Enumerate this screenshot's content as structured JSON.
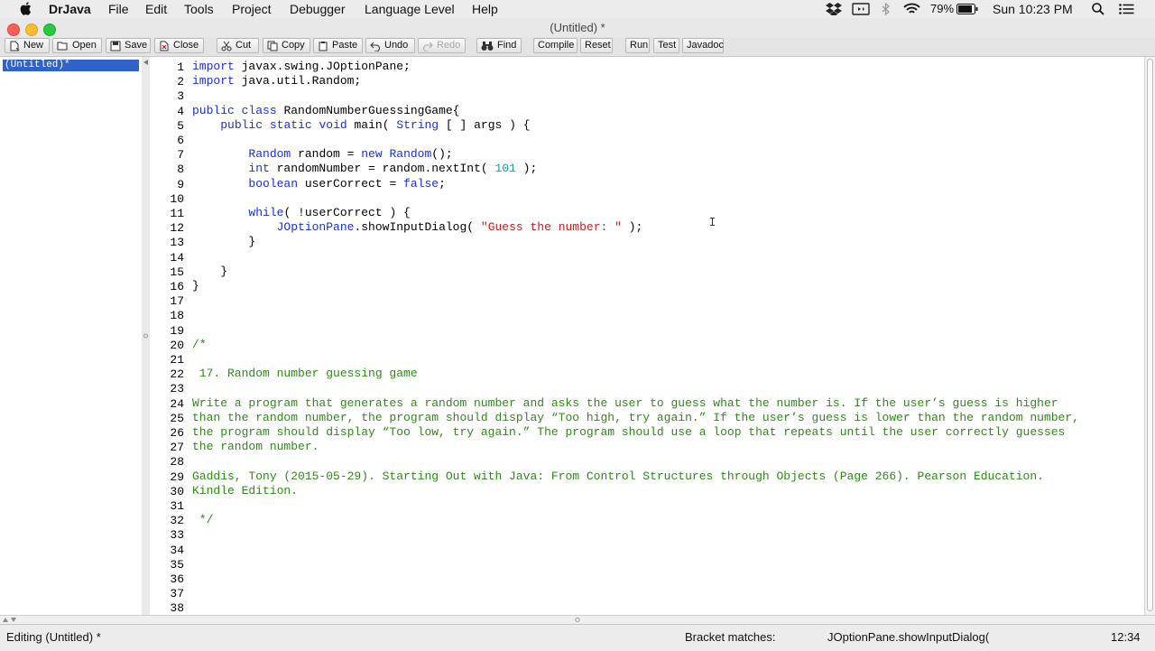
{
  "menubar": {
    "app_name": "DrJava",
    "items": [
      "File",
      "Edit",
      "Tools",
      "Project",
      "Debugger",
      "Language Level",
      "Help"
    ],
    "battery": "79%",
    "clock": "Sun 10:23 PM"
  },
  "window": {
    "title": "(Untitled) *"
  },
  "toolbar": {
    "new": "New",
    "open": "Open",
    "save": "Save",
    "close": "Close",
    "cut": "Cut",
    "copy": "Copy",
    "paste": "Paste",
    "undo": "Undo",
    "redo": "Redo",
    "find": "Find",
    "compile": "Compile",
    "reset": "Reset",
    "run": "Run",
    "test": "Test",
    "javadoc": "Javadoc"
  },
  "sidebar": {
    "documents": [
      "(Untitled)*"
    ]
  },
  "editor": {
    "line_numbers": [
      "1",
      "2",
      "3",
      "4",
      "5",
      "6",
      "7",
      "8",
      "9",
      "10",
      "11",
      "12",
      "13",
      "14",
      "15",
      "16",
      "17",
      "18",
      "19",
      "20",
      "21",
      "22",
      "23",
      "24",
      "25",
      "26",
      "27",
      "28",
      "29",
      "30",
      "31",
      "32",
      "33",
      "34",
      "35",
      "36",
      "37",
      "38"
    ],
    "lines": {
      "l1_kw": "import",
      "l1_rest": " javax.swing.JOptionPane;",
      "l2_kw": "import",
      "l2_rest": " java.util.Random;",
      "l4_kw1": "public",
      "l4_sp1": " ",
      "l4_kw2": "class",
      "l4_rest": " RandomNumberGuessingGame{",
      "l5_ind": "    ",
      "l5_kw1": "public",
      "l5_sp1": " ",
      "l5_kw2": "static",
      "l5_sp2": " ",
      "l5_kw3": "void",
      "l5_mid": " main( ",
      "l5_tp": "String",
      "l5_rest": " [ ] args ) {",
      "l7_ind": "        ",
      "l7_tp1": "Random",
      "l7_mid": " random = ",
      "l7_kw": "new",
      "l7_sp": " ",
      "l7_tp2": "Random",
      "l7_rest": "();",
      "l8_ind": "        ",
      "l8_kw": "int",
      "l8_mid": " randomNumber = random.nextInt( ",
      "l8_num": "101",
      "l8_rest": " );",
      "l9_ind": "        ",
      "l9_kw": "boolean",
      "l9_mid": " userCorrect = ",
      "l9_kw2": "false",
      "l9_rest": ";",
      "l11_ind": "        ",
      "l11_kw": "while",
      "l11_rest": "( !userCorrect ) {",
      "l12_ind": "            ",
      "l12_tp": "JOptionPane",
      "l12_mid": ".showInputDialog( ",
      "l12_str": "\"Guess the number: \"",
      "l12_rest": " );",
      "l13": "        }",
      "l15": "    }",
      "l16": "}",
      "l20": "/*",
      "l22": " 17. Random number guessing game",
      "l24": "Write a program that generates a random number and asks the user to guess what the number is. If the user’s guess is higher",
      "l25": "than the random number, the program should display “Too high, try again.” If the user’s guess is lower than the random number,",
      "l26": "the program should display “Too low, try again.” The program should use a loop that repeats until the user correctly guesses",
      "l27": "the random number.",
      "l29": "Gaddis, Tony (2015-05-29). Starting Out with Java: From Control Structures through Objects (Page 266). Pearson Education.",
      "l30": "Kindle Edition.",
      "l32": " */"
    }
  },
  "statusbar": {
    "mode": "Editing (Untitled) *",
    "bracket_label": "Bracket matches:",
    "bracket_value": "JOptionPane.showInputDialog(",
    "cursor_pos": "12:34"
  }
}
